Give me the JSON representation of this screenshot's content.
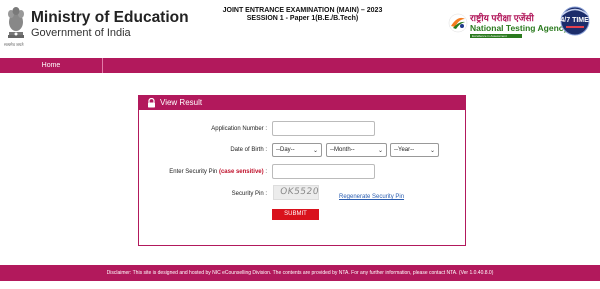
{
  "header": {
    "ministry_title": "Ministry of Education",
    "ministry_subtitle": "Government of India",
    "emblem_caption": "सत्यमेव जयते",
    "exam_title": "JOINT ENTRANCE EXAMINATION (MAIN) – 2023",
    "exam_session": "SESSION 1 - Paper 1(B.E./B.Tech)",
    "nta_hindi": "राष्ट्रीय परीक्षा एजेंसी",
    "nta_english": "National Testing Agency",
    "nta_tagline": "Excellence in Assessment",
    "badge_text": "24/7 TIMES"
  },
  "nav": {
    "home_label": "Home"
  },
  "panel": {
    "title": "View Result",
    "application_number_label": "Application Number :",
    "application_number_value": "",
    "dob_label": "Date of Birth :",
    "dob_day": "--Day--",
    "dob_month": "--Month--",
    "dob_year": "--Year--",
    "security_pin_entry_label": "Enter Security Pin",
    "security_pin_entry_note": "(case sensitive)",
    "security_pin_entry_colon": ":",
    "security_pin_entry_value": "",
    "security_pin_label": "Security Pin :",
    "captcha_text": "OK5520",
    "regenerate_label": "Regenerate Security Pin",
    "submit_label": "SUBMIT"
  },
  "footer": {
    "disclaimer": "Disclaimer: This site is designed and hosted by NIC eCounselling Division. The contents are provided by NTA. For any further information, please contact NTA. (Ver 1.0.40.8.0)"
  },
  "colors": {
    "brand": "#b2195c",
    "submit": "#d9111c",
    "link": "#2a5db0",
    "nta_green": "#2a7a1e"
  }
}
